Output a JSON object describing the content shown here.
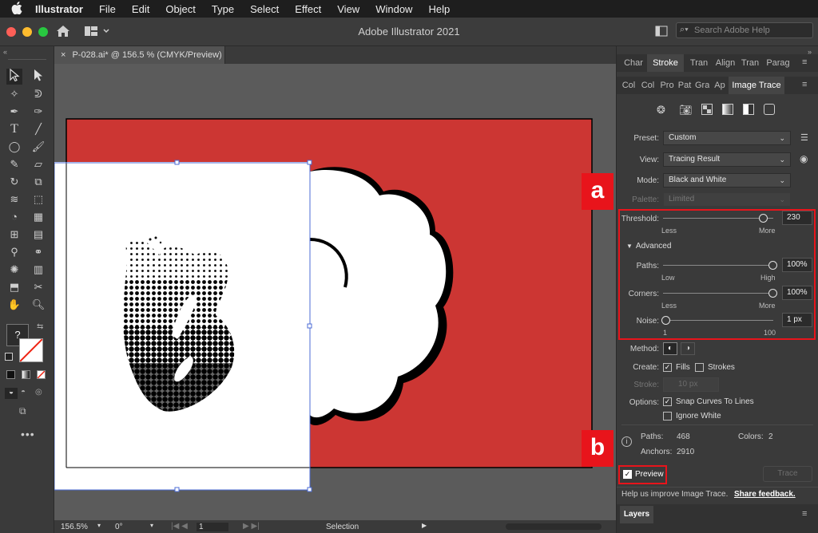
{
  "menubar": {
    "apple": "",
    "app": "Illustrator",
    "items": [
      "File",
      "Edit",
      "Object",
      "Type",
      "Select",
      "Effect",
      "View",
      "Window",
      "Help"
    ]
  },
  "window": {
    "title": "Adobe Illustrator 2021",
    "search_placeholder": "Search Adobe Help"
  },
  "document": {
    "tab_label": "P-028.ai* @ 156.5 % (CMYK/Preview)"
  },
  "status": {
    "zoom": "156.5%",
    "rotation": "0°",
    "artboard": "1",
    "tool": "Selection"
  },
  "panel_tabs_row1": [
    "Char",
    "Stroke",
    "Tran",
    "Align",
    "Tran",
    "Parag"
  ],
  "panel_tabs_row2": [
    "Col",
    "Col",
    "Pro",
    "Pat",
    "Gra",
    "Ap",
    "Image Trace"
  ],
  "trace": {
    "preset_label": "Preset:",
    "preset_value": "Custom",
    "view_label": "View:",
    "view_value": "Tracing Result",
    "mode_label": "Mode:",
    "mode_value": "Black and White",
    "palette_label": "Palette:",
    "palette_value": "Limited",
    "threshold_label": "Threshold:",
    "threshold_value": "230",
    "threshold_level": 0.91,
    "threshold_min": "Less",
    "threshold_max": "More",
    "advanced_label": "Advanced",
    "paths_label": "Paths:",
    "paths_value": "100%",
    "paths_min": "Low",
    "paths_max": "High",
    "corners_label": "Corners:",
    "corners_value": "100%",
    "corners_min": "Less",
    "corners_max": "More",
    "noise_label": "Noise:",
    "noise_value": "1 px",
    "noise_min": "1",
    "noise_max": "100",
    "method_label": "Method:",
    "create_label": "Create:",
    "fills_label": "Fills",
    "strokes_label": "Strokes",
    "fills_checked": true,
    "strokes_checked": false,
    "stroke_label": "Stroke:",
    "stroke_value": "10 px",
    "options_label": "Options:",
    "snap_label": "Snap Curves To Lines",
    "snap_checked": true,
    "ignore_white_label": "Ignore White",
    "ignore_white_checked": false,
    "paths_count_label": "Paths:",
    "paths_count": "468",
    "colors_label": "Colors:",
    "colors_count": "2",
    "anchors_label": "Anchors:",
    "anchors_count": "2910",
    "preview_label": "Preview",
    "preview_checked": true,
    "trace_button": "Trace",
    "feedback_text": "Help us improve Image Trace.",
    "feedback_link": "Share feedback."
  },
  "layers_tab": "Layers",
  "annotations": {
    "a": "a",
    "b": "b",
    "color": "#e8141b"
  },
  "colors": {
    "artboard_red": "#cc3633",
    "accent_blue": "#4b6bd6"
  }
}
